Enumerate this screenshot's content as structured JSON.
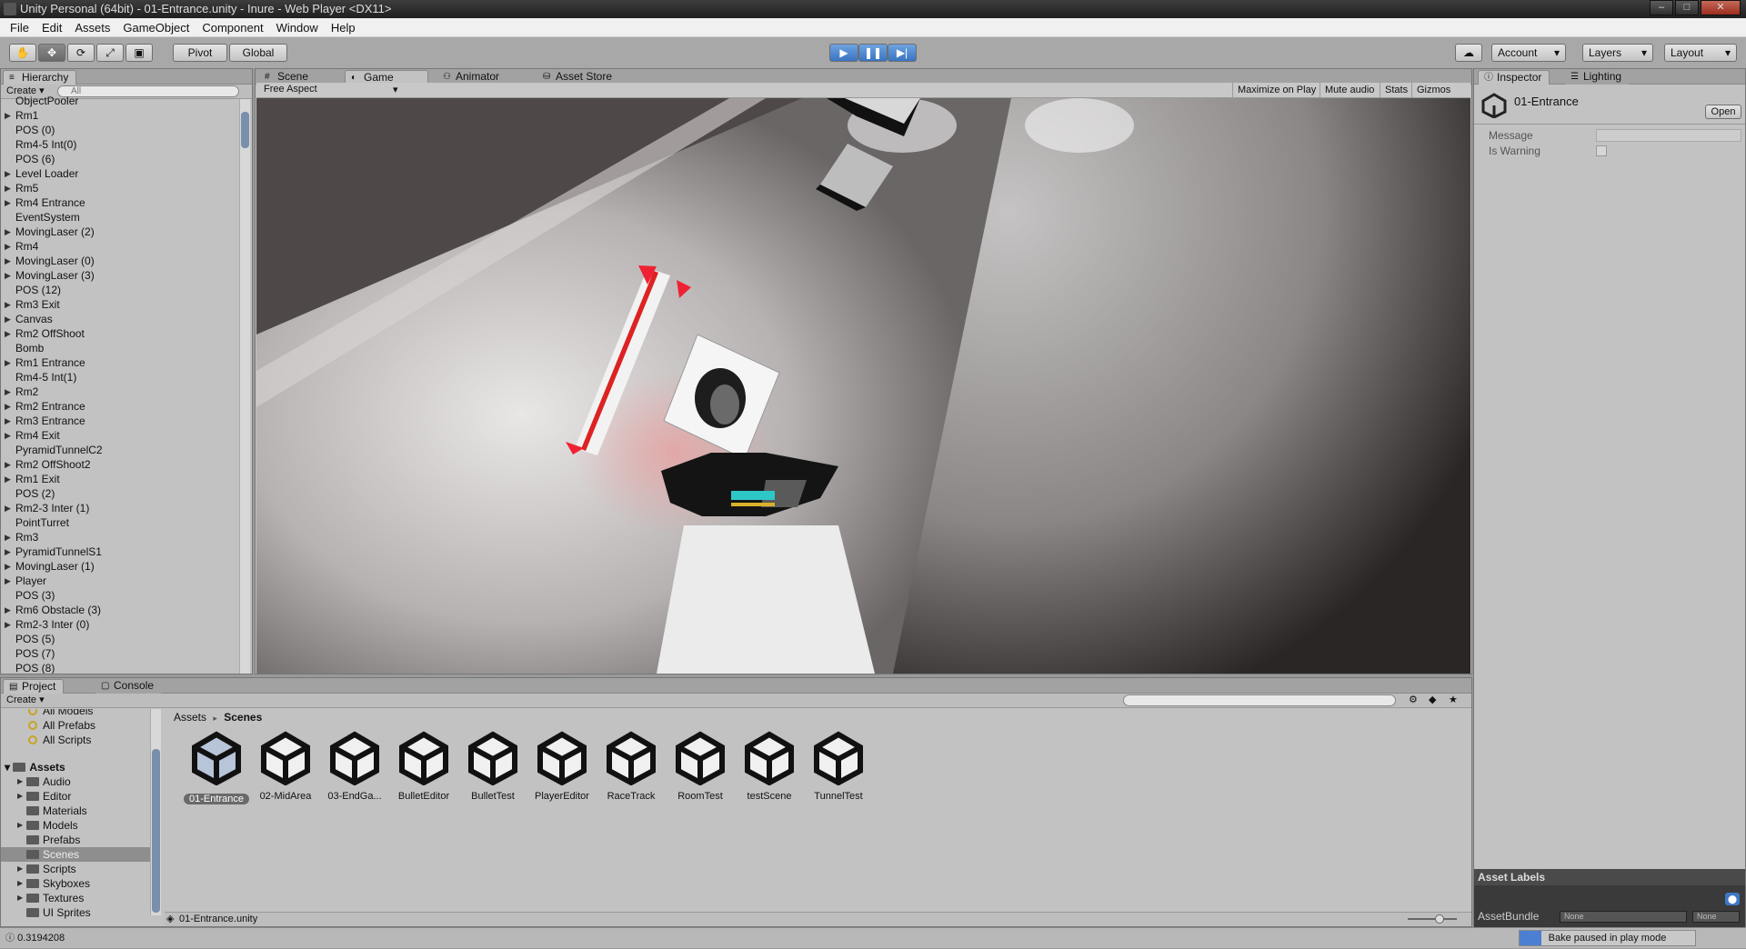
{
  "window": {
    "title": "Unity Personal (64bit) - 01-Entrance.unity - Inure - Web Player <DX11>"
  },
  "menu": [
    "File",
    "Edit",
    "Assets",
    "GameObject",
    "Component",
    "Window",
    "Help"
  ],
  "toolbar": {
    "pivot": "Pivot",
    "global": "Global",
    "account": "Account",
    "layers": "Layers",
    "layout": "Layout"
  },
  "hierarchy": {
    "tab": "Hierarchy",
    "create": "Create",
    "search_placeholder": "All",
    "items": [
      {
        "label": "ObjectPooler",
        "arrow": false
      },
      {
        "label": "Rm1",
        "arrow": true
      },
      {
        "label": "POS (0)",
        "arrow": false
      },
      {
        "label": "Rm4-5 Int(0)",
        "arrow": false
      },
      {
        "label": "POS (6)",
        "arrow": false
      },
      {
        "label": "Level Loader",
        "arrow": true
      },
      {
        "label": "Rm5",
        "arrow": true
      },
      {
        "label": "Rm4 Entrance",
        "arrow": true
      },
      {
        "label": "EventSystem",
        "arrow": false
      },
      {
        "label": "MovingLaser (2)",
        "arrow": true
      },
      {
        "label": "Rm4",
        "arrow": true
      },
      {
        "label": "MovingLaser (0)",
        "arrow": true
      },
      {
        "label": "MovingLaser (3)",
        "arrow": true
      },
      {
        "label": "POS (12)",
        "arrow": false
      },
      {
        "label": "Rm3 Exit",
        "arrow": true
      },
      {
        "label": "Canvas",
        "arrow": true
      },
      {
        "label": "Rm2 OffShoot",
        "arrow": true
      },
      {
        "label": "Bomb",
        "arrow": false
      },
      {
        "label": "Rm1 Entrance",
        "arrow": true
      },
      {
        "label": "Rm4-5 Int(1)",
        "arrow": false
      },
      {
        "label": "Rm2",
        "arrow": true
      },
      {
        "label": "Rm2 Entrance",
        "arrow": true
      },
      {
        "label": "Rm3 Entrance",
        "arrow": true
      },
      {
        "label": "Rm4 Exit",
        "arrow": true
      },
      {
        "label": "PyramidTunnelC2",
        "arrow": false
      },
      {
        "label": "Rm2 OffShoot2",
        "arrow": true
      },
      {
        "label": "Rm1 Exit",
        "arrow": true
      },
      {
        "label": "POS (2)",
        "arrow": false
      },
      {
        "label": "Rm2-3 Inter (1)",
        "arrow": true
      },
      {
        "label": "PointTurret",
        "arrow": false
      },
      {
        "label": "Rm3",
        "arrow": true
      },
      {
        "label": "PyramidTunnelS1",
        "arrow": true
      },
      {
        "label": "MovingLaser (1)",
        "arrow": true
      },
      {
        "label": "Player",
        "arrow": true
      },
      {
        "label": "POS (3)",
        "arrow": false
      },
      {
        "label": "Rm6 Obstacle (3)",
        "arrow": true
      },
      {
        "label": "Rm2-3 Inter (0)",
        "arrow": true
      },
      {
        "label": "POS (5)",
        "arrow": false
      },
      {
        "label": "POS (7)",
        "arrow": false
      },
      {
        "label": "POS (8)",
        "arrow": false
      }
    ]
  },
  "center_tabs": [
    "Scene",
    "Game",
    "Animator",
    "Asset Store"
  ],
  "game": {
    "aspect": "Free Aspect",
    "buttons": [
      "Maximize on Play",
      "Mute audio",
      "Stats",
      "Gizmos"
    ]
  },
  "inspector": {
    "tabs": [
      "Inspector",
      "Lighting"
    ],
    "object_name": "01-Entrance",
    "open": "Open",
    "fields": [
      {
        "label": "Message"
      },
      {
        "label": "Is Warning"
      }
    ],
    "asset_labels": "Asset Labels",
    "asset_bundle": "AssetBundle",
    "bundle_value": "None",
    "variant_value": "None"
  },
  "project": {
    "tabs": [
      "Project",
      "Console"
    ],
    "create": "Create",
    "favorites": [
      "All Models",
      "All Prefabs",
      "All Scripts"
    ],
    "root": "Assets",
    "folders": [
      {
        "label": "Audio",
        "arrow": true,
        "selected": false
      },
      {
        "label": "Editor",
        "arrow": true,
        "selected": false
      },
      {
        "label": "Materials",
        "arrow": false,
        "selected": false
      },
      {
        "label": "Models",
        "arrow": true,
        "selected": false
      },
      {
        "label": "Prefabs",
        "arrow": false,
        "selected": false
      },
      {
        "label": "Scenes",
        "arrow": false,
        "selected": true
      },
      {
        "label": "Scripts",
        "arrow": true,
        "selected": false
      },
      {
        "label": "Skyboxes",
        "arrow": true,
        "selected": false
      },
      {
        "label": "Textures",
        "arrow": true,
        "selected": false
      },
      {
        "label": "UI Sprites",
        "arrow": false,
        "selected": false
      }
    ],
    "breadcrumb": [
      "Assets",
      "Scenes"
    ],
    "assets": [
      "01-Entrance",
      "02-MidArea",
      "03-EndGa...",
      "BulletEditor",
      "BulletTest",
      "PlayerEditor",
      "RaceTrack",
      "RoomTest",
      "testScene",
      "TunnelTest"
    ],
    "footer_file": "01-Entrance.unity"
  },
  "status": {
    "value": "0.3194208",
    "bake": "Bake paused in play mode"
  }
}
